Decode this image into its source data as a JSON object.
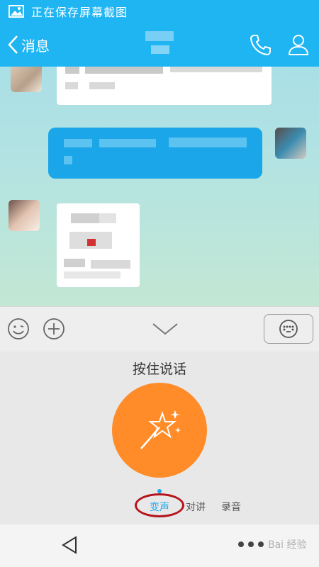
{
  "status_bar": {
    "text": "正在保存屏幕截图",
    "icon": "image-icon"
  },
  "header": {
    "back_label": "消息",
    "back_icon": "chevron-left-icon",
    "phone_icon": "phone-icon",
    "profile_icon": "person-icon"
  },
  "toolbar": {
    "emoji_icon": "smiley-icon",
    "plus_icon": "plus-icon",
    "collapse_icon": "chevron-down-icon",
    "keyboard_icon": "keyboard-icon"
  },
  "voice_panel": {
    "hint": "按住说话",
    "button_icon": "magic-wand-icon",
    "tabs": [
      {
        "label": "变声",
        "active": true
      },
      {
        "label": "对讲",
        "active": false
      },
      {
        "label": "录音",
        "active": false
      }
    ]
  },
  "nav_bar": {
    "back_icon": "triangle-back-icon",
    "home_icon": "dots-icon"
  },
  "watermark": {
    "text": "Bai 经验"
  },
  "colors": {
    "accent": "#1fb5f2",
    "voice_button": "#ff8c28",
    "active_tab": "#1ea7ee",
    "annotation": "#b5141c"
  }
}
